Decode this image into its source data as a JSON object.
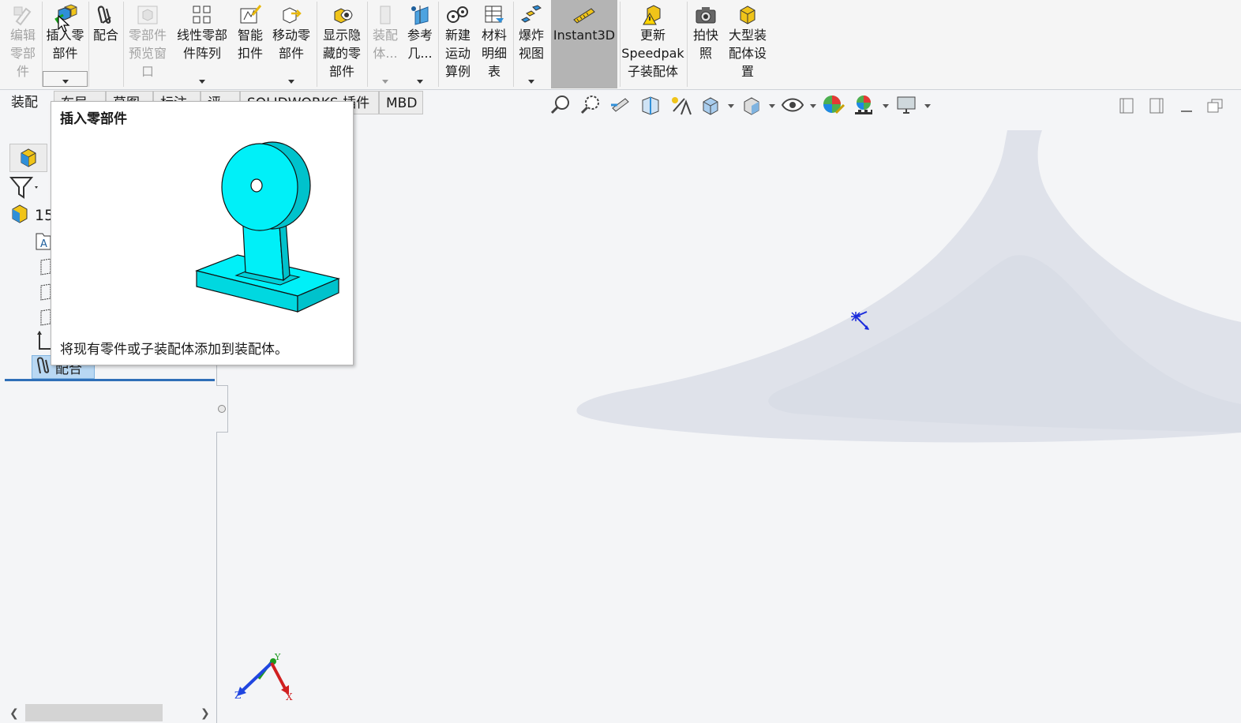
{
  "ribbon": {
    "buttons": [
      {
        "label": "编辑\n零部\n件",
        "icon": "edit-component-icon",
        "disabled": true
      },
      {
        "label": "插入零\n部件",
        "icon": "insert-component-icon",
        "disabled": false
      },
      {
        "label": "配合",
        "icon": "mate-paperclip-icon",
        "disabled": false
      },
      {
        "label": "零部件\n预览窗\n口",
        "icon": "component-preview-icon",
        "disabled": true
      },
      {
        "label": "线性零部\n件阵列",
        "icon": "linear-pattern-icon",
        "disabled": false
      },
      {
        "label": "智能\n扣件",
        "icon": "smart-fastener-icon",
        "disabled": false
      },
      {
        "label": "移动零\n部件",
        "icon": "move-component-icon",
        "disabled": false
      },
      {
        "label": "显示隐\n藏的零\n部件",
        "icon": "show-hidden-icon",
        "disabled": false
      },
      {
        "label": "装配\n体...",
        "icon": "assembly-feature-icon",
        "disabled": true
      },
      {
        "label": "参考\n几...",
        "icon": "reference-geometry-icon",
        "disabled": false
      },
      {
        "label": "新建\n运动\n算例",
        "icon": "motion-study-icon",
        "disabled": false
      },
      {
        "label": "材料\n明细\n表",
        "icon": "bom-table-icon",
        "disabled": false
      },
      {
        "label": "爆炸\n视图",
        "icon": "exploded-view-icon",
        "disabled": false
      },
      {
        "label": "Instant3D",
        "icon": "instant3d-icon",
        "disabled": false,
        "active": true
      },
      {
        "label": "更新\nSpeedpak\n子装配体",
        "icon": "speedpak-icon",
        "disabled": false
      },
      {
        "label": "拍快\n照",
        "icon": "camera-icon",
        "disabled": false
      },
      {
        "label": "大型装\n配体设\n置",
        "icon": "large-assembly-icon",
        "disabled": false
      }
    ]
  },
  "tabs": [
    "装配体",
    "布局",
    "草图",
    "标注",
    "评估",
    "SOLIDWORKS 插件",
    "MBD"
  ],
  "tooltip": {
    "title": "插入零部件",
    "description": "将现有零件或子装配体添加到装配体。"
  },
  "tree": {
    "root_label": "15",
    "mates_label": "配合"
  },
  "triad": {
    "x": "X",
    "y": "Y",
    "z": "Z"
  },
  "colors": {
    "accent": "#0078d7",
    "part_cyan": "#00e5ee",
    "floor_shadow": "#dfe2ea",
    "active_button": "#b4b4b4"
  }
}
